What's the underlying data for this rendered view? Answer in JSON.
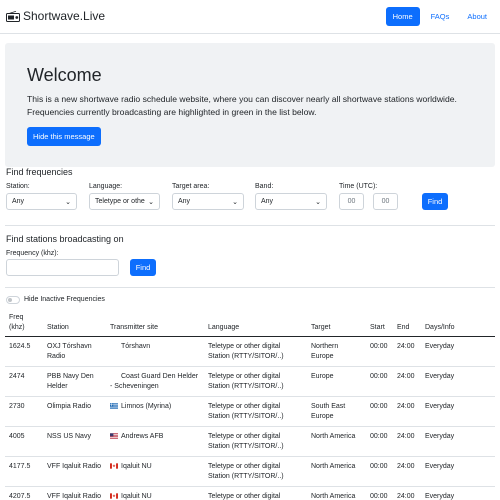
{
  "header": {
    "brand": "Shortwave.Live",
    "nav": [
      {
        "label": "Home",
        "active": true
      },
      {
        "label": "FAQs",
        "active": false
      },
      {
        "label": "About",
        "active": false
      }
    ]
  },
  "hero": {
    "title": "Welcome",
    "text": "This is a new shortwave radio schedule website, where you can discover nearly all shortwave stations worldwide. Frequencies currently broadcasting are highlighted in green in the list below.",
    "button": "Hide this message"
  },
  "find_frequencies": {
    "title": "Find frequencies",
    "station_label": "Station:",
    "station_value": "Any",
    "language_label": "Language:",
    "language_value": "Teletype or othe",
    "target_label": "Target area:",
    "target_value": "Any",
    "band_label": "Band:",
    "band_value": "Any",
    "time_label": "Time (UTC):",
    "time_from_placeholder": "00",
    "time_to_placeholder": "00",
    "find_button": "Find"
  },
  "find_stations": {
    "title": "Find stations broadcasting on",
    "freq_label": "Frequency (khz):",
    "find_button": "Find"
  },
  "toggle": {
    "label": "Hide Inactive Frequencies"
  },
  "table": {
    "headers": {
      "freq_line1": "Freq",
      "freq_line2": "(khz)",
      "station": "Station",
      "site": "Transmitter site",
      "language": "Language",
      "target": "Target",
      "start": "Start",
      "end": "End",
      "days": "Days/Info"
    },
    "rows": [
      {
        "freq": "1624.5",
        "station1": "OXJ Tórshavn",
        "station2": "Radio",
        "site1": "Tórshavn",
        "site2": "",
        "flag": "",
        "lang1": "Teletype or other digital",
        "lang2": "Station (RTTY/SITOR/..)",
        "target1": "Northern",
        "target2": "Europe",
        "start": "00:00",
        "end": "24:00",
        "days": "Everyday"
      },
      {
        "freq": "2474",
        "station1": "PBB Navy Den",
        "station2": "Helder",
        "site1": "Coast Guard Den Helder",
        "site2": "- Scheveningen",
        "flag": "",
        "lang1": "Teletype or other digital",
        "lang2": "Station (RTTY/SITOR/..)",
        "target1": "Europe",
        "target2": "",
        "start": "00:00",
        "end": "24:00",
        "days": "Everyday"
      },
      {
        "freq": "2730",
        "station1": "Olimpia Radio",
        "station2": "",
        "site1": "Limnos (Myrina)",
        "site2": "",
        "flag": "greece",
        "lang1": "Teletype or other digital",
        "lang2": "Station (RTTY/SITOR/..)",
        "target1": "South East",
        "target2": "Europe",
        "start": "00:00",
        "end": "24:00",
        "days": "Everyday"
      },
      {
        "freq": "4005",
        "station1": "NSS US Navy",
        "station2": "",
        "site1": "Andrews AFB",
        "site2": "",
        "flag": "usa",
        "lang1": "Teletype or other digital",
        "lang2": "Station (RTTY/SITOR/..)",
        "target1": "North America",
        "target2": "",
        "start": "00:00",
        "end": "24:00",
        "days": "Everyday"
      },
      {
        "freq": "4177.5",
        "station1": "VFF Iqaluit Radio",
        "station2": "",
        "site1": "Iqaluit NU",
        "site2": "",
        "flag": "canada",
        "lang1": "Teletype or other digital",
        "lang2": "Station (RTTY/SITOR/..)",
        "target1": "North America",
        "target2": "",
        "start": "00:00",
        "end": "24:00",
        "days": "Everyday"
      },
      {
        "freq": "4207.5",
        "station1": "VFF Iqaluit Radio",
        "station2": "",
        "site1": "Iqaluit NU",
        "site2": "",
        "flag": "canada",
        "lang1": "Teletype or other digital",
        "lang2": "",
        "target1": "North America",
        "target2": "",
        "start": "00:00",
        "end": "24:00",
        "days": "Everyday"
      }
    ]
  },
  "colors": {
    "accent": "#0d6efd",
    "hero_bg": "#f0f2f4",
    "text": "#212529"
  }
}
